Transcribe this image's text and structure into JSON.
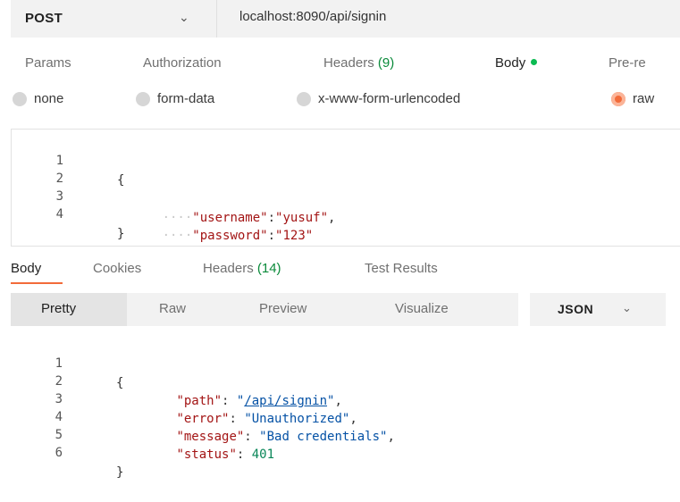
{
  "request": {
    "method": "POST",
    "url": "localhost:8090/api/signin"
  },
  "request_tabs": {
    "params": "Params",
    "authorization": "Authorization",
    "headers": "Headers",
    "headers_count": "(9)",
    "body": "Body",
    "prerequest": "Pre-re"
  },
  "body_types": {
    "none": "none",
    "form_data": "form-data",
    "urlencoded": "x-www-form-urlencoded",
    "raw": "raw",
    "selected": "raw"
  },
  "request_body": {
    "line_numbers": [
      "1",
      "2",
      "3",
      "4"
    ],
    "open": "{",
    "close": "}",
    "username_key": "\"username\"",
    "username_value": "\"yusuf\"",
    "password_key": "\"password\"",
    "password_value": "\"123\""
  },
  "response_tabs": {
    "body": "Body",
    "cookies": "Cookies",
    "headers": "Headers",
    "headers_count": "(14)",
    "test_results": "Test Results"
  },
  "view_modes": {
    "pretty": "Pretty",
    "raw": "Raw",
    "preview": "Preview",
    "visualize": "Visualize",
    "format": "JSON"
  },
  "response_body": {
    "line_numbers": [
      "1",
      "2",
      "3",
      "4",
      "5",
      "6"
    ],
    "open": "{",
    "close": "}",
    "path_key": "\"path\"",
    "path_value": "\"/api/signin\"",
    "error_key": "\"error\"",
    "error_value": "\"Unauthorized\"",
    "message_key": "\"message\"",
    "message_value": "\"Bad credentials\"",
    "status_key": "\"status\"",
    "status_value": "401"
  },
  "colors": {
    "accent": "#f26b3a",
    "status_green": "#0cbb52",
    "count_green": "#0a8a3a"
  }
}
